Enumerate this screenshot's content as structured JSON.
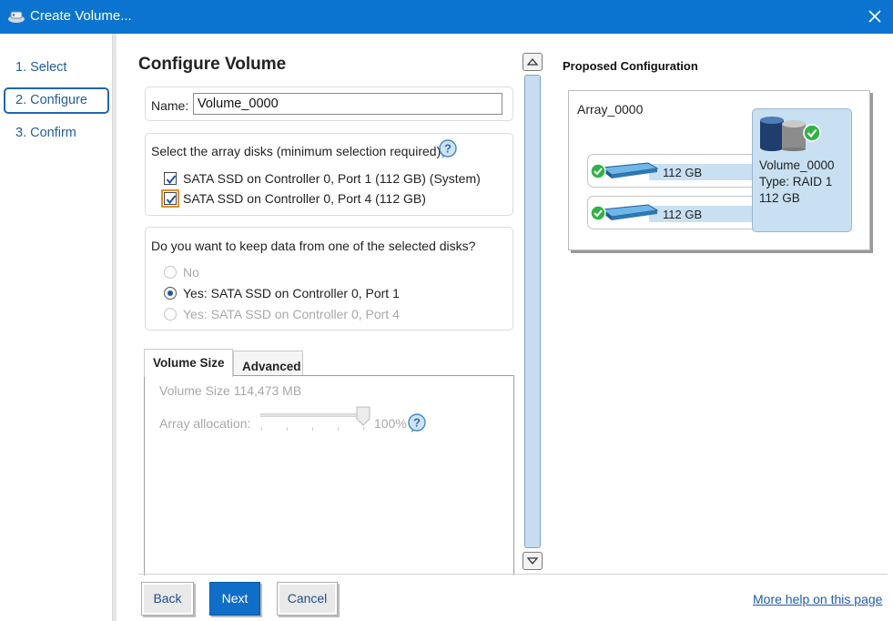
{
  "window": {
    "title": "Create Volume...",
    "title_icon": "app-disk-icon",
    "close_icon": "close-icon",
    "accent_color": "#0a74d0"
  },
  "steps": [
    {
      "label": "1. Select",
      "active": false
    },
    {
      "label": "2. Configure",
      "active": true
    },
    {
      "label": "3. Confirm",
      "active": false
    }
  ],
  "main": {
    "heading": "Configure Volume",
    "name_label": "Name:",
    "name_value": "Volume_0000",
    "disks": {
      "prompt": "Select the array disks (minimum selection required):",
      "items": [
        {
          "label": "SATA SSD on Controller 0, Port 1 (112 GB) (System)",
          "checked": true
        },
        {
          "label": "SATA SSD on Controller 0, Port 4 (112 GB)",
          "checked": true
        }
      ]
    },
    "keep_data": {
      "prompt": "Do you want to keep data from one of the selected disks?",
      "options": [
        {
          "label": "No",
          "selected": false,
          "enabled": false
        },
        {
          "label": "Yes: SATA SSD on Controller 0, Port 1",
          "selected": true,
          "enabled": true
        },
        {
          "label": "Yes: SATA SSD on Controller 0, Port 4",
          "selected": false,
          "enabled": false
        }
      ]
    },
    "tabs": [
      {
        "label": "Volume Size",
        "active": true
      },
      {
        "label": "Advanced",
        "active": false
      }
    ],
    "volume_size_text": "Volume Size  114,473 MB",
    "array_allocation_label": "Array allocation:",
    "array_allocation_value": "100%",
    "array_allocation_fraction": 1.0
  },
  "proposed": {
    "title": "Proposed Configuration",
    "array_name": "Array_0000",
    "disks": [
      {
        "size": "112 GB"
      },
      {
        "size": "112 GB"
      }
    ],
    "volume": {
      "name": "Volume_0000",
      "type": "Type: RAID 1",
      "size": "112 GB"
    }
  },
  "footer": {
    "back": "Back",
    "next": "Next",
    "cancel": "Cancel",
    "help_link": "More help on this page"
  }
}
